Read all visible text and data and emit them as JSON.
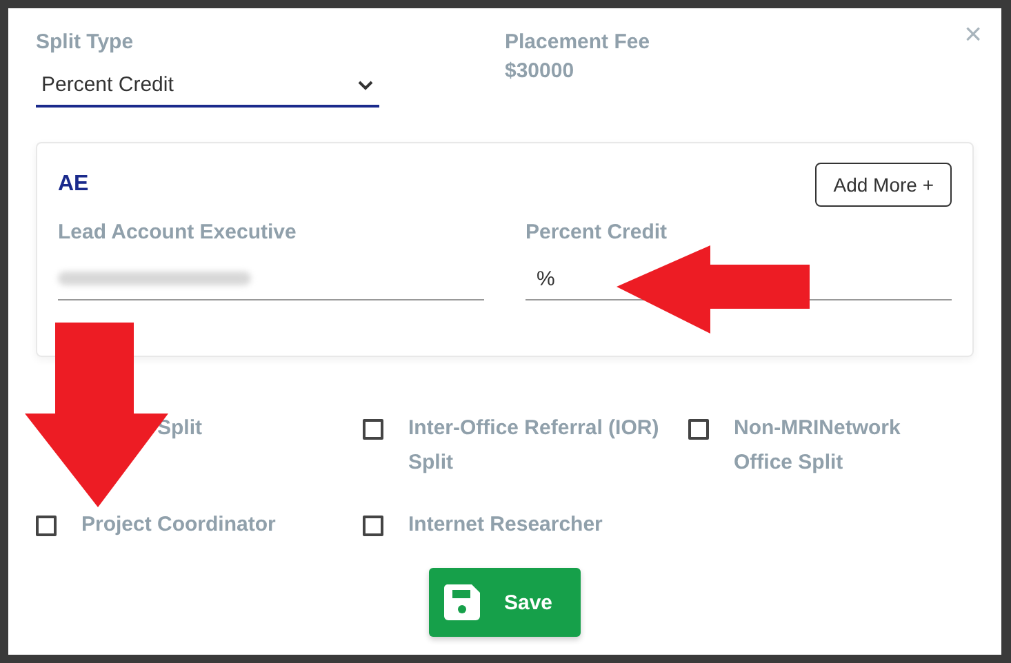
{
  "close_icon": "×",
  "split_type": {
    "label": "Split Type",
    "value": "Percent Credit"
  },
  "placement_fee": {
    "label": "Placement Fee",
    "value": "$30000"
  },
  "ae_card": {
    "title": "AE",
    "add_button": "Add More +",
    "lead_label": "Lead Account Executive",
    "credit_label": "Percent Credit",
    "credit_value": "%"
  },
  "options": [
    {
      "kind": "cut",
      "label": "Split"
    },
    {
      "kind": "checkbox",
      "label": "Inter-Office Referral (IOR) Split",
      "checked": false
    },
    {
      "kind": "checkbox",
      "label": "Non-MRINetwork Office Split",
      "checked": false
    },
    {
      "kind": "checkbox",
      "label": "Project Coordinator",
      "checked": false
    },
    {
      "kind": "checkbox",
      "label": "Internet Researcher",
      "checked": false
    }
  ],
  "save_button": "Save"
}
